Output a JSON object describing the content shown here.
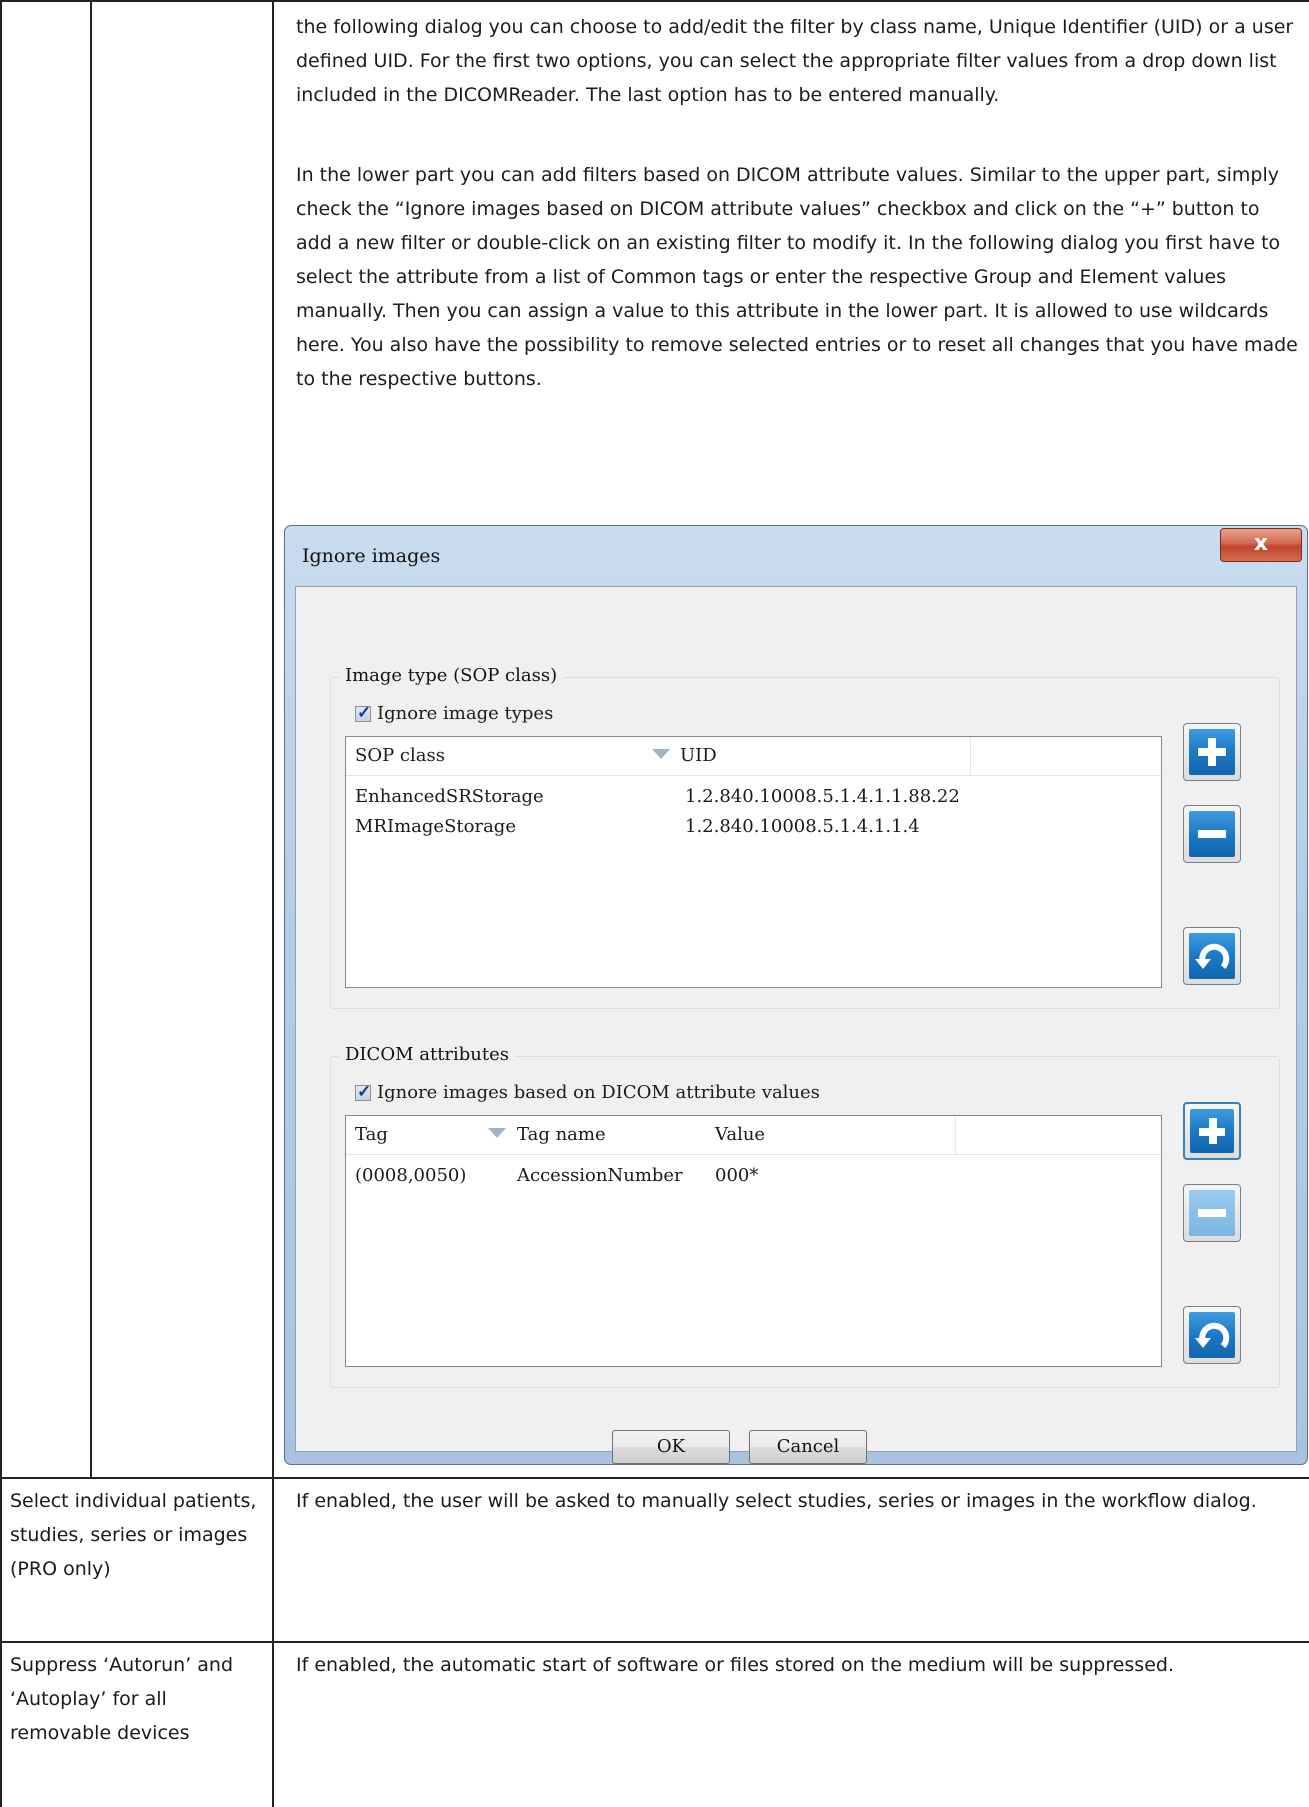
{
  "paragraphs": {
    "p1": "the following dialog you can choose to add/edit the filter by class name, Unique Identifier (UID) or a user defined UID. For the first two options, you can select the appropriate filter values from a drop down list included in the DICOMReader. The last option has to be entered manually.",
    "p2": "In the lower part you can add filters based on DICOM attribute values. Similar to the upper part, simply check the “Ignore images based on DICOM attribute values” checkbox and click on the “+” button to add a new filter or double-click on an existing filter to modify it. In the following dialog you first have to select the attribute from a list of Common tags or enter the respective Group and Element values manually. Then you can assign a value to this attribute in the lower part. It is allowed to use wildcards here. You also have the possibility to remove selected entries or to reset all changes that you have made to the respective buttons."
  },
  "dialog": {
    "title": "Ignore images",
    "close_label": "x",
    "group1": {
      "title": "Image type (SOP class)",
      "checkbox_label": "Ignore image types",
      "columns": [
        "SOP class",
        "UID"
      ],
      "rows": [
        {
          "sop_class": "EnhancedSRStorage",
          "uid": "1.2.840.10008.5.1.4.1.1.88.22"
        },
        {
          "sop_class": "MRImageStorage",
          "uid": "1.2.840.10008.5.1.4.1.1.4"
        }
      ]
    },
    "group2": {
      "title": "DICOM attributes",
      "checkbox_label": "Ignore images based on DICOM attribute values",
      "columns": [
        "Tag",
        "Tag name",
        "Value"
      ],
      "rows": [
        {
          "tag": "(0008,0050)",
          "tag_name": "AccessionNumber",
          "value": "000*"
        }
      ]
    },
    "ok_label": "OK",
    "cancel_label": "Cancel"
  },
  "table_rows": [
    {
      "label": "Select individual patients, studies, series or images (PRO only)",
      "description": "If enabled, the user will be asked to manually select studies, series or images in the workflow dialog."
    },
    {
      "label": "Suppress ‘Autorun’ and ‘Autoplay’ for all removable devices",
      "description": "If enabled, the automatic start of software or files stored on the medium will be suppressed."
    }
  ]
}
